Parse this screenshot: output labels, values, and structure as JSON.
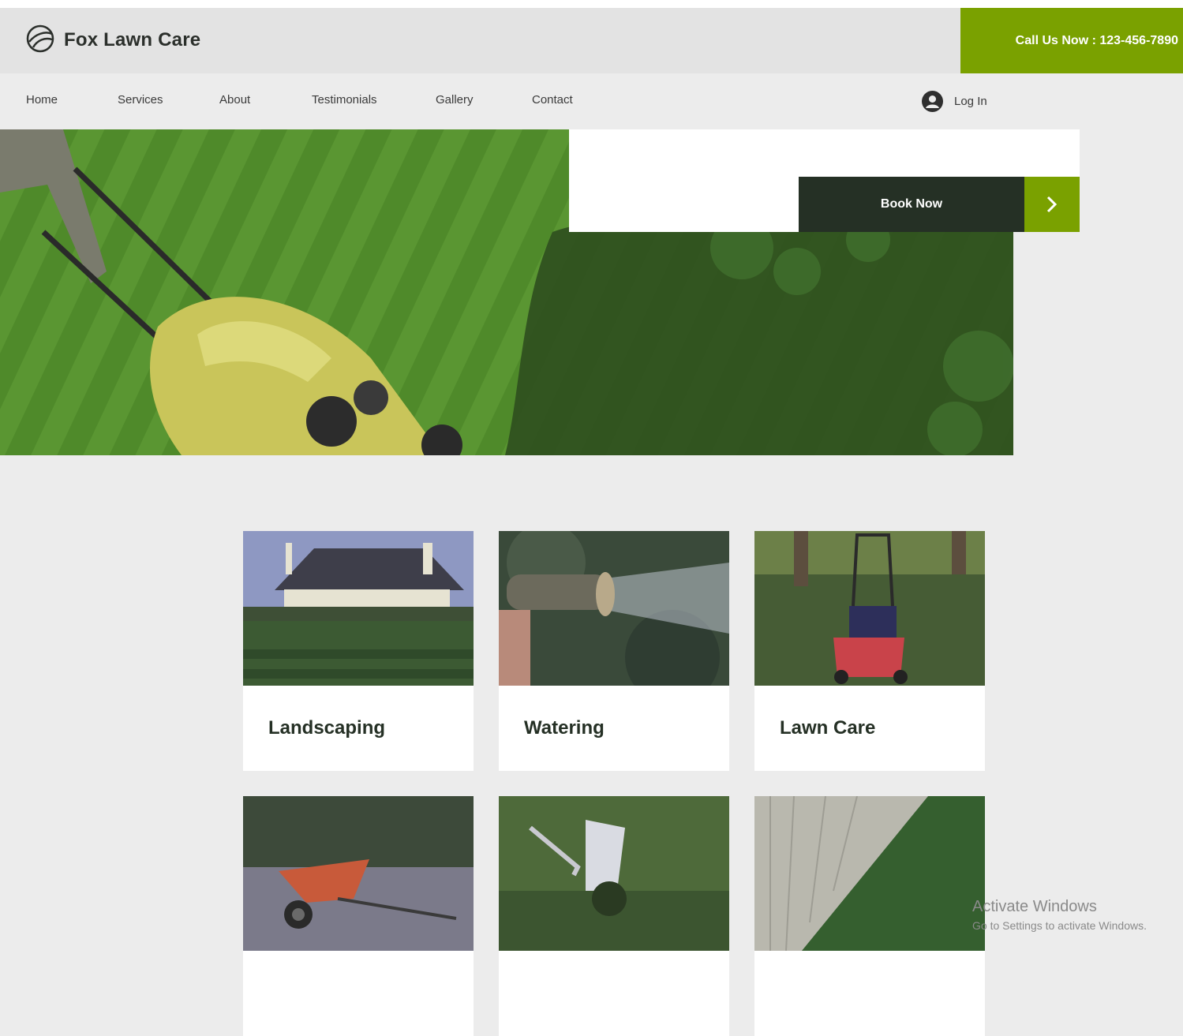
{
  "header": {
    "site_name": "Fox Lawn Care",
    "call_text": "Call Us Now : 123-456-7890",
    "accent_color": "#7aa100"
  },
  "nav": {
    "items": [
      "Home",
      "Services",
      "About",
      "Testimonials",
      "Gallery",
      "Contact"
    ],
    "login_label": "Log In"
  },
  "hero": {
    "book_label": "Book Now"
  },
  "services": [
    {
      "title": "Landscaping",
      "image": "house-lawn-image"
    },
    {
      "title": "Watering",
      "image": "hose-spray-image"
    },
    {
      "title": "Lawn Care",
      "image": "lawn-mower-image"
    },
    {
      "title": "",
      "image": "wheelbarrow-image"
    },
    {
      "title": "",
      "image": "weeding-tool-image"
    },
    {
      "title": "",
      "image": "fence-lawn-image"
    }
  ],
  "watermark": {
    "title": "Activate Windows",
    "subtitle": "Go to Settings to activate Windows."
  }
}
